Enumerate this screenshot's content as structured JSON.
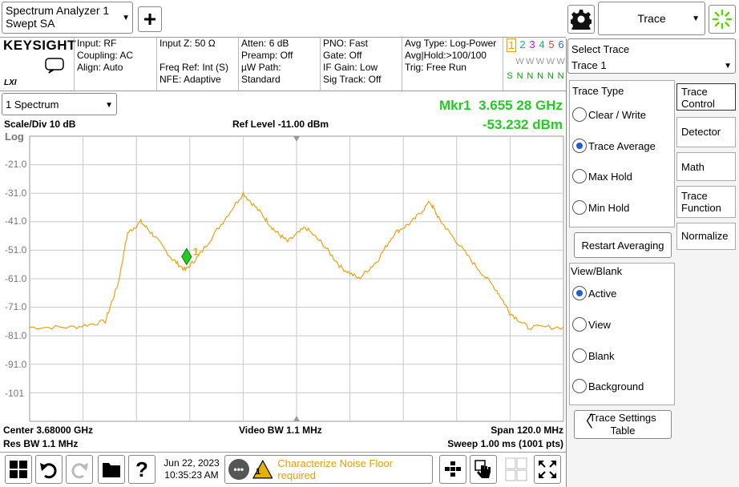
{
  "title_bar": {
    "app_line1": "Spectrum Analyzer 1",
    "app_line2": "Swept SA",
    "add_symbol": "+",
    "mode_button_label": "Trace",
    "mode_dropdown_arrow": "▼"
  },
  "header": {
    "brand": "KEYSIGHT",
    "lxi": "LXI",
    "col1": [
      "Input: RF",
      "Coupling: AC",
      "Align: Auto"
    ],
    "col2": [
      "Input Z: 50 Ω",
      "",
      "Freq Ref: Int (S)",
      "NFE: Adaptive"
    ],
    "col3": [
      "Atten: 6 dB",
      "Preamp: Off",
      "µW Path: Standard"
    ],
    "col4": [
      "PNO: Fast",
      "Gate: Off",
      "IF Gain: Low",
      "Sig Track: Off"
    ],
    "col5": [
      "Avg Type: Log-Power",
      "Avg|Hold:>100/100",
      "Trig: Free Run"
    ],
    "trace_nums": [
      "1",
      "2",
      "3",
      "4",
      "5",
      "6"
    ],
    "trace_w_row": [
      "W",
      "W",
      "W",
      "W",
      "W",
      "W"
    ],
    "trace_s_row": [
      "S",
      "N",
      "N",
      "N",
      "N",
      "N"
    ]
  },
  "window": {
    "selector": "1 Spectrum",
    "marker_label": "Mkr1",
    "marker_freq": "3.655 28 GHz",
    "marker_amp": "-53.232 dBm",
    "scale": "Scale/Div 10 dB",
    "ref_level": "Ref Level -11.00 dBm",
    "log": "Log",
    "marker_number": "1",
    "y_ticks": [
      "-21.0",
      "-31.0",
      "-41.0",
      "-51.0",
      "-61.0",
      "-71.0",
      "-81.0",
      "-91.0",
      "-101"
    ],
    "center": "Center 3.68000 GHz",
    "res_bw": "Res BW 1.1 MHz",
    "video_bw": "Video BW 1.1 MHz",
    "span": "Span 120.0 MHz",
    "sweep": "Sweep 1.00 ms (1001 pts)"
  },
  "right_panel": {
    "select_trace_label": "Select Trace",
    "select_trace_value": "Trace 1",
    "trace_type_label": "Trace Type",
    "trace_types": [
      "Clear / Write",
      "Trace Average",
      "Max Hold",
      "Min Hold"
    ],
    "trace_type_selected": 1,
    "restart_button": "Restart Averaging",
    "view_blank_label": "View/Blank",
    "view_options": [
      "Active",
      "View",
      "Blank",
      "Background"
    ],
    "view_selected": 0,
    "settings_table": [
      "Trace Settings",
      "Table"
    ]
  },
  "side_menu": {
    "items": [
      [
        "Trace",
        "Control"
      ],
      [
        "Detector"
      ],
      [
        "Math"
      ],
      [
        "Trace",
        "Function"
      ],
      [
        "Normalize"
      ]
    ]
  },
  "status_bar": {
    "date": "Jun 22, 2023",
    "time": "10:35:23 AM",
    "message_count": "1",
    "message": "Characterize Noise Floor required"
  },
  "colors": {
    "trace": "#f0a010",
    "marker_text": "#22cc22",
    "marker_diamond": "#22cc22",
    "grid": "#c8c8c8",
    "warning": "#e8b000",
    "selected_radio": "#1e5bd8"
  },
  "chart_data": {
    "type": "line",
    "title": "",
    "xlabel": "",
    "ylabel": "",
    "x_center_ghz": 3.68,
    "x_span_mhz": 120,
    "xlim_ghz": [
      3.62,
      3.74
    ],
    "ylim": [
      -111,
      -11
    ],
    "series": [
      {
        "x": [
          3.62,
          3.63,
          3.637,
          3.64,
          3.642,
          3.645,
          3.648,
          3.652,
          3.655,
          3.658,
          3.663,
          3.668,
          3.672,
          3.675,
          3.678,
          3.682,
          3.686,
          3.69,
          3.694,
          3.698,
          3.702,
          3.706,
          3.71,
          3.712,
          3.715,
          3.72,
          3.725,
          3.728,
          3.732,
          3.74
        ],
        "y": [
          -78,
          -78,
          -76,
          -62,
          -45,
          -41,
          -46,
          -54,
          -58,
          -53,
          -42,
          -31,
          -38,
          -44,
          -48,
          -43,
          -49,
          -57,
          -61,
          -55,
          -45,
          -41,
          -34,
          -40,
          -46,
          -56,
          -65,
          -73,
          -78,
          -78
        ]
      }
    ],
    "marker": {
      "x": 3.65528,
      "y": -53.232
    }
  }
}
